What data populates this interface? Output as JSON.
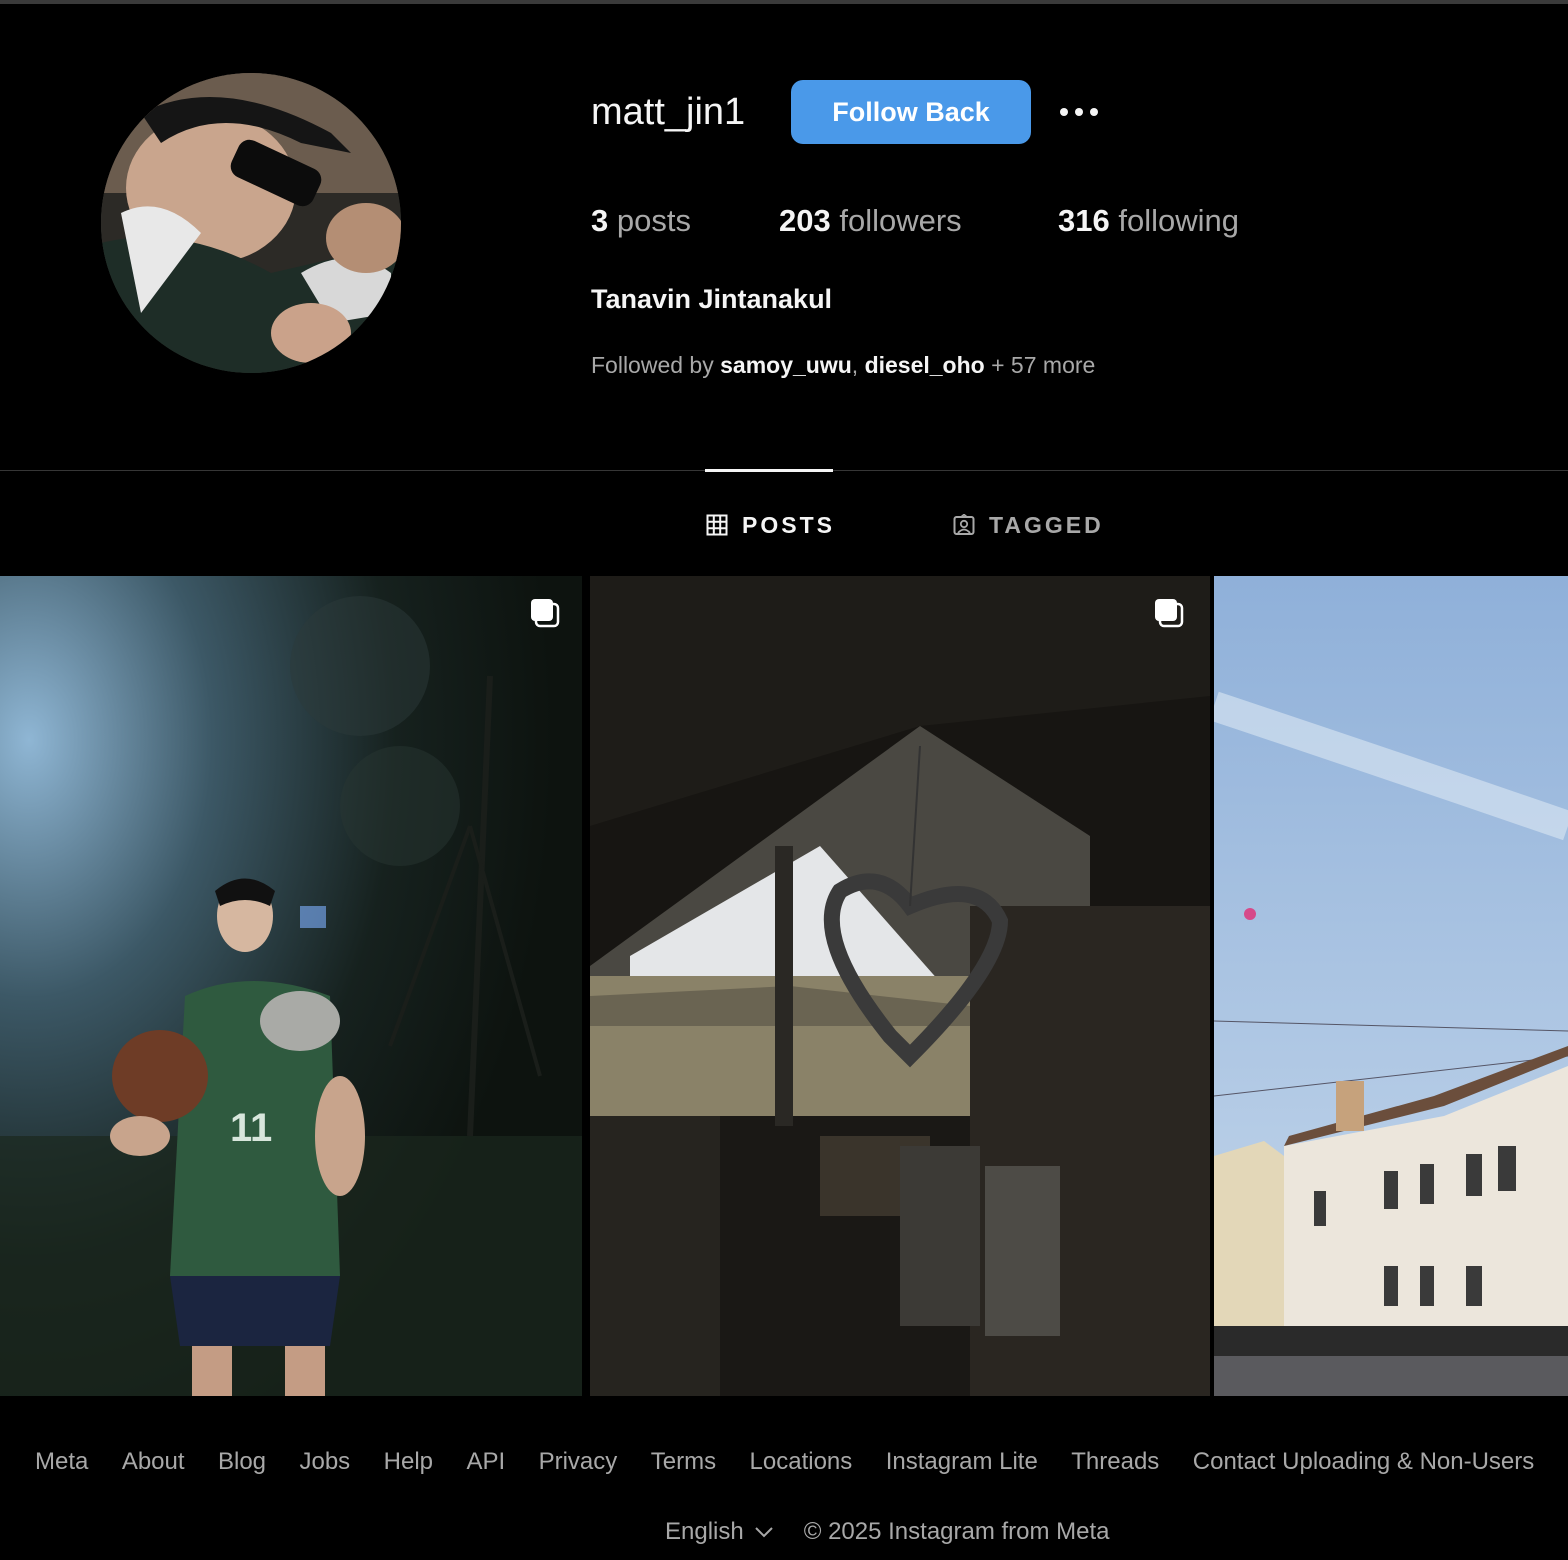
{
  "profile": {
    "username": "matt_jin1",
    "follow_label": "Follow Back",
    "posts_count": "3",
    "posts_label": "posts",
    "followers_count": "203",
    "followers_label": "followers",
    "following_count": "316",
    "following_label": "following",
    "full_name": "Tanavin Jintanakul",
    "followed_by_prefix": "Followed by",
    "followed_by_users": [
      "samoy_uwu",
      "diesel_oho"
    ],
    "followed_by_sep": ",",
    "followed_by_suffix": "+ 57 more"
  },
  "tabs": [
    {
      "label": "POSTS",
      "icon": "grid-icon",
      "active": true
    },
    {
      "label": "TAGGED",
      "icon": "tagged-person-icon",
      "active": false
    }
  ],
  "posts": [
    {
      "kind": "carousel",
      "icon": "multi-image-icon"
    },
    {
      "kind": "carousel",
      "icon": "multi-image-icon"
    },
    {
      "kind": "single"
    }
  ],
  "footer": {
    "links": [
      "Meta",
      "About",
      "Blog",
      "Jobs",
      "Help",
      "API",
      "Privacy",
      "Terms",
      "Locations",
      "Instagram Lite",
      "Threads",
      "Contact Uploading & Non-Users"
    ],
    "language": "English",
    "copyright": "© 2025 Instagram from Meta"
  },
  "colors": {
    "background": "#000000",
    "follow_button": "#4a99e9",
    "secondary_text": "#a8a8a8"
  }
}
